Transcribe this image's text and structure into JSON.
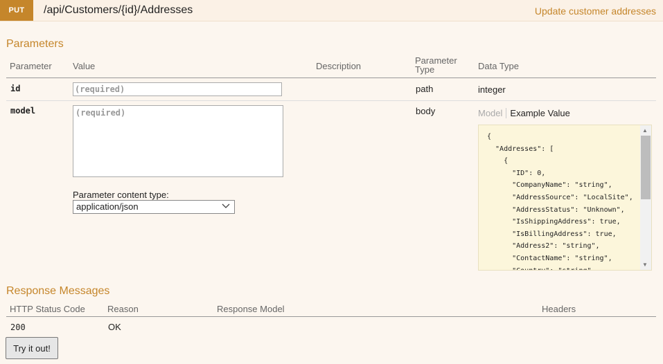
{
  "operation": {
    "method": "PUT",
    "path": "/api/Customers/{id}/Addresses",
    "summary": "Update customer addresses"
  },
  "parameters": {
    "title": "Parameters",
    "headers": {
      "parameter": "Parameter",
      "value": "Value",
      "description": "Description",
      "param_type": "Parameter\nType",
      "data_type": "Data Type"
    },
    "rows": [
      {
        "name": "id",
        "placeholder": "(required)",
        "param_type": "path",
        "data_type": "integer"
      },
      {
        "name": "model",
        "placeholder": "(required)",
        "param_type": "body",
        "content_type_label": "Parameter content type:",
        "content_type_value": "application/json"
      }
    ],
    "signature_tabs": {
      "model": "Model",
      "example": "Example Value"
    },
    "example_json": "{\n  \"Addresses\": [\n    {\n      \"ID\": 0,\n      \"CompanyName\": \"string\",\n      \"AddressSource\": \"LocalSite\",\n      \"AddressStatus\": \"Unknown\",\n      \"IsShippingAddress\": true,\n      \"IsBillingAddress\": true,\n      \"Address2\": \"string\",\n      \"ContactName\": \"string\",\n      \"Country\": \"string\","
  },
  "responses": {
    "title": "Response Messages",
    "headers": {
      "status": "HTTP Status Code",
      "reason": "Reason",
      "model": "Response Model",
      "headers": "Headers"
    },
    "rows": [
      {
        "status": "200",
        "reason": "OK"
      }
    ]
  },
  "try_button": "Try it out!",
  "colors": {
    "accent": "#c5862b",
    "background": "#fcf6ef",
    "code_bg": "#fcf6db"
  }
}
